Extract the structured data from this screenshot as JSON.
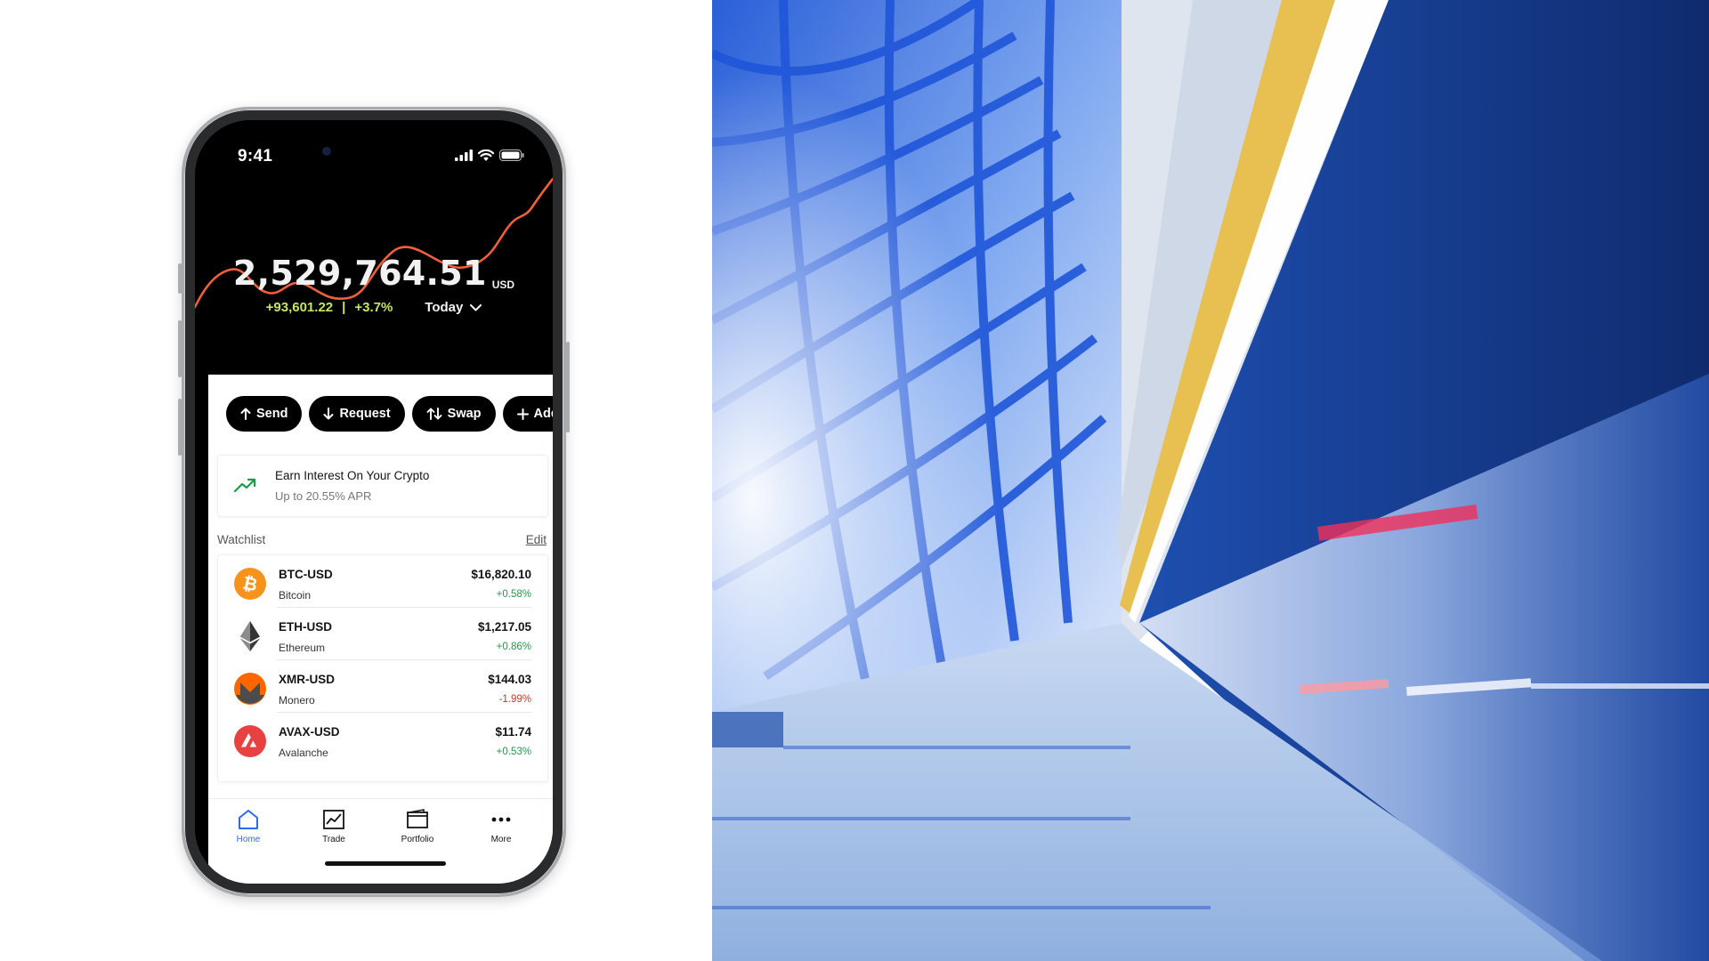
{
  "status_bar": {
    "time": "9:41"
  },
  "portfolio": {
    "balance": "2,529,764.51",
    "currency": "USD",
    "change_amount": "+93,601.22",
    "separator": "|",
    "change_percent": "+3.7%",
    "period": "Today"
  },
  "actions": [
    {
      "label": "Send",
      "icon": "arrow-up-icon"
    },
    {
      "label": "Request",
      "icon": "arrow-down-icon"
    },
    {
      "label": "Swap",
      "icon": "swap-icon"
    },
    {
      "label": "Add",
      "icon": "plus-icon"
    }
  ],
  "earn": {
    "title": "Earn Interest On Your Crypto",
    "subtitle": "Up to 20.55% APR",
    "icon": "trend-up-icon"
  },
  "watchlist": {
    "title": "Watchlist",
    "edit_label": "Edit",
    "items": [
      {
        "symbol": "BTC-USD",
        "name": "Bitcoin",
        "price": "$16,820.10",
        "change": "+0.58%",
        "direction": "up",
        "icon": "bitcoin-icon",
        "color": "#f7931a"
      },
      {
        "symbol": "ETH-USD",
        "name": "Ethereum",
        "price": "$1,217.05",
        "change": "+0.86%",
        "direction": "up",
        "icon": "ethereum-icon",
        "color": "#343434"
      },
      {
        "symbol": "XMR-USD",
        "name": "Monero",
        "price": "$144.03",
        "change": "-1.99%",
        "direction": "down",
        "icon": "monero-icon",
        "color": "#ff6600"
      },
      {
        "symbol": "AVAX-USD",
        "name": "Avalanche",
        "price": "$11.74",
        "change": "+0.53%",
        "direction": "up",
        "icon": "avalanche-icon",
        "color": "#e84142"
      }
    ]
  },
  "tabs": [
    {
      "label": "Home",
      "icon": "home-icon",
      "active": true
    },
    {
      "label": "Trade",
      "icon": "chart-icon",
      "active": false
    },
    {
      "label": "Portfolio",
      "icon": "wallet-icon",
      "active": false
    },
    {
      "label": "More",
      "icon": "more-icon",
      "active": false
    }
  ],
  "colors": {
    "chart_line": "#f0603a",
    "positive": "#1a9b4a",
    "negative": "#e02a2a",
    "change_highlight": "#c5e75e",
    "active_tab": "#2a6bf2"
  }
}
